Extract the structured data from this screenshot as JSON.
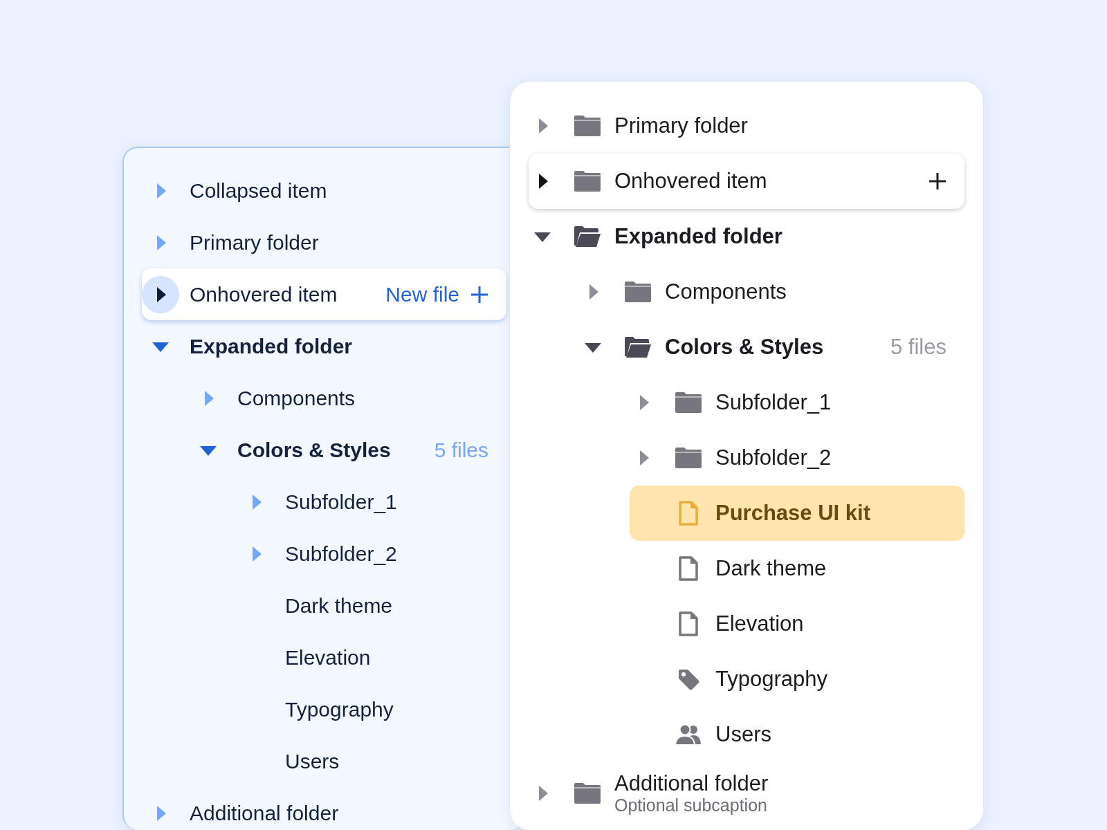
{
  "panels": [
    {
      "kind": "blue",
      "items": [
        {
          "kind": "folder",
          "label": "Collapsed item",
          "expanded": false,
          "hovered": false,
          "selected": false
        },
        {
          "kind": "folder",
          "label": "Primary folder",
          "expanded": false,
          "hovered": false,
          "selected": false
        },
        {
          "kind": "folder",
          "label": "Onhovered item",
          "expanded": false,
          "hovered": true,
          "selected": false,
          "action": "New file"
        },
        {
          "kind": "folder",
          "label": "Expanded folder",
          "expanded": true,
          "hovered": false,
          "selected": false,
          "children": [
            {
              "kind": "folder",
              "label": "Components",
              "expanded": false,
              "hovered": false,
              "selected": false
            },
            {
              "kind": "folder",
              "label": "Colors & Styles",
              "expanded": true,
              "hovered": false,
              "selected": false,
              "count": "5 files",
              "children": [
                {
                  "kind": "folder",
                  "label": "Subfolder_1",
                  "expanded": false,
                  "hovered": false,
                  "selected": false
                },
                {
                  "kind": "folder",
                  "label": "Subfolder_2",
                  "expanded": false,
                  "hovered": false,
                  "selected": false
                },
                {
                  "kind": "item",
                  "label": "Dark theme",
                  "hovered": false,
                  "selected": false
                },
                {
                  "kind": "item",
                  "label": "Elevation",
                  "hovered": false,
                  "selected": false
                },
                {
                  "kind": "item",
                  "label": "Typography",
                  "hovered": false,
                  "selected": false
                },
                {
                  "kind": "item",
                  "label": "Users",
                  "hovered": false,
                  "selected": false
                }
              ]
            }
          ]
        },
        {
          "kind": "folder",
          "label": "Additional folder",
          "expanded": false,
          "hovered": false,
          "selected": false
        }
      ]
    },
    {
      "kind": "gray",
      "items": [
        {
          "kind": "folder",
          "label": "Primary folder",
          "expanded": false,
          "hovered": false,
          "selected": false
        },
        {
          "kind": "folder",
          "label": "Onhovered item",
          "expanded": false,
          "hovered": true,
          "selected": false
        },
        {
          "kind": "folder",
          "label": "Expanded folder",
          "expanded": true,
          "hovered": false,
          "selected": false,
          "children": [
            {
              "kind": "folder",
              "label": "Components",
              "expanded": false,
              "hovered": false,
              "selected": false
            },
            {
              "kind": "folder",
              "label": "Colors & Styles",
              "expanded": true,
              "hovered": false,
              "selected": false,
              "count": "5 files",
              "children": [
                {
                  "kind": "folder",
                  "label": "Subfolder_1",
                  "expanded": false,
                  "hovered": false,
                  "selected": false
                },
                {
                  "kind": "folder",
                  "label": "Subfolder_2",
                  "expanded": false,
                  "hovered": false,
                  "selected": false
                },
                {
                  "kind": "file",
                  "label": "Purchase UI kit",
                  "hovered": false,
                  "selected": true
                },
                {
                  "kind": "file",
                  "label": "Dark theme",
                  "hovered": false,
                  "selected": false
                },
                {
                  "kind": "file",
                  "label": "Elevation",
                  "hovered": false,
                  "selected": false
                },
                {
                  "kind": "tag",
                  "label": "Typography",
                  "hovered": false,
                  "selected": false
                },
                {
                  "kind": "users",
                  "label": "Users",
                  "hovered": false,
                  "selected": false
                }
              ]
            }
          ]
        },
        {
          "kind": "folder",
          "label": "Additional folder",
          "expanded": false,
          "hovered": false,
          "selected": false,
          "subcaption": "Optional subcaption"
        }
      ]
    }
  ]
}
